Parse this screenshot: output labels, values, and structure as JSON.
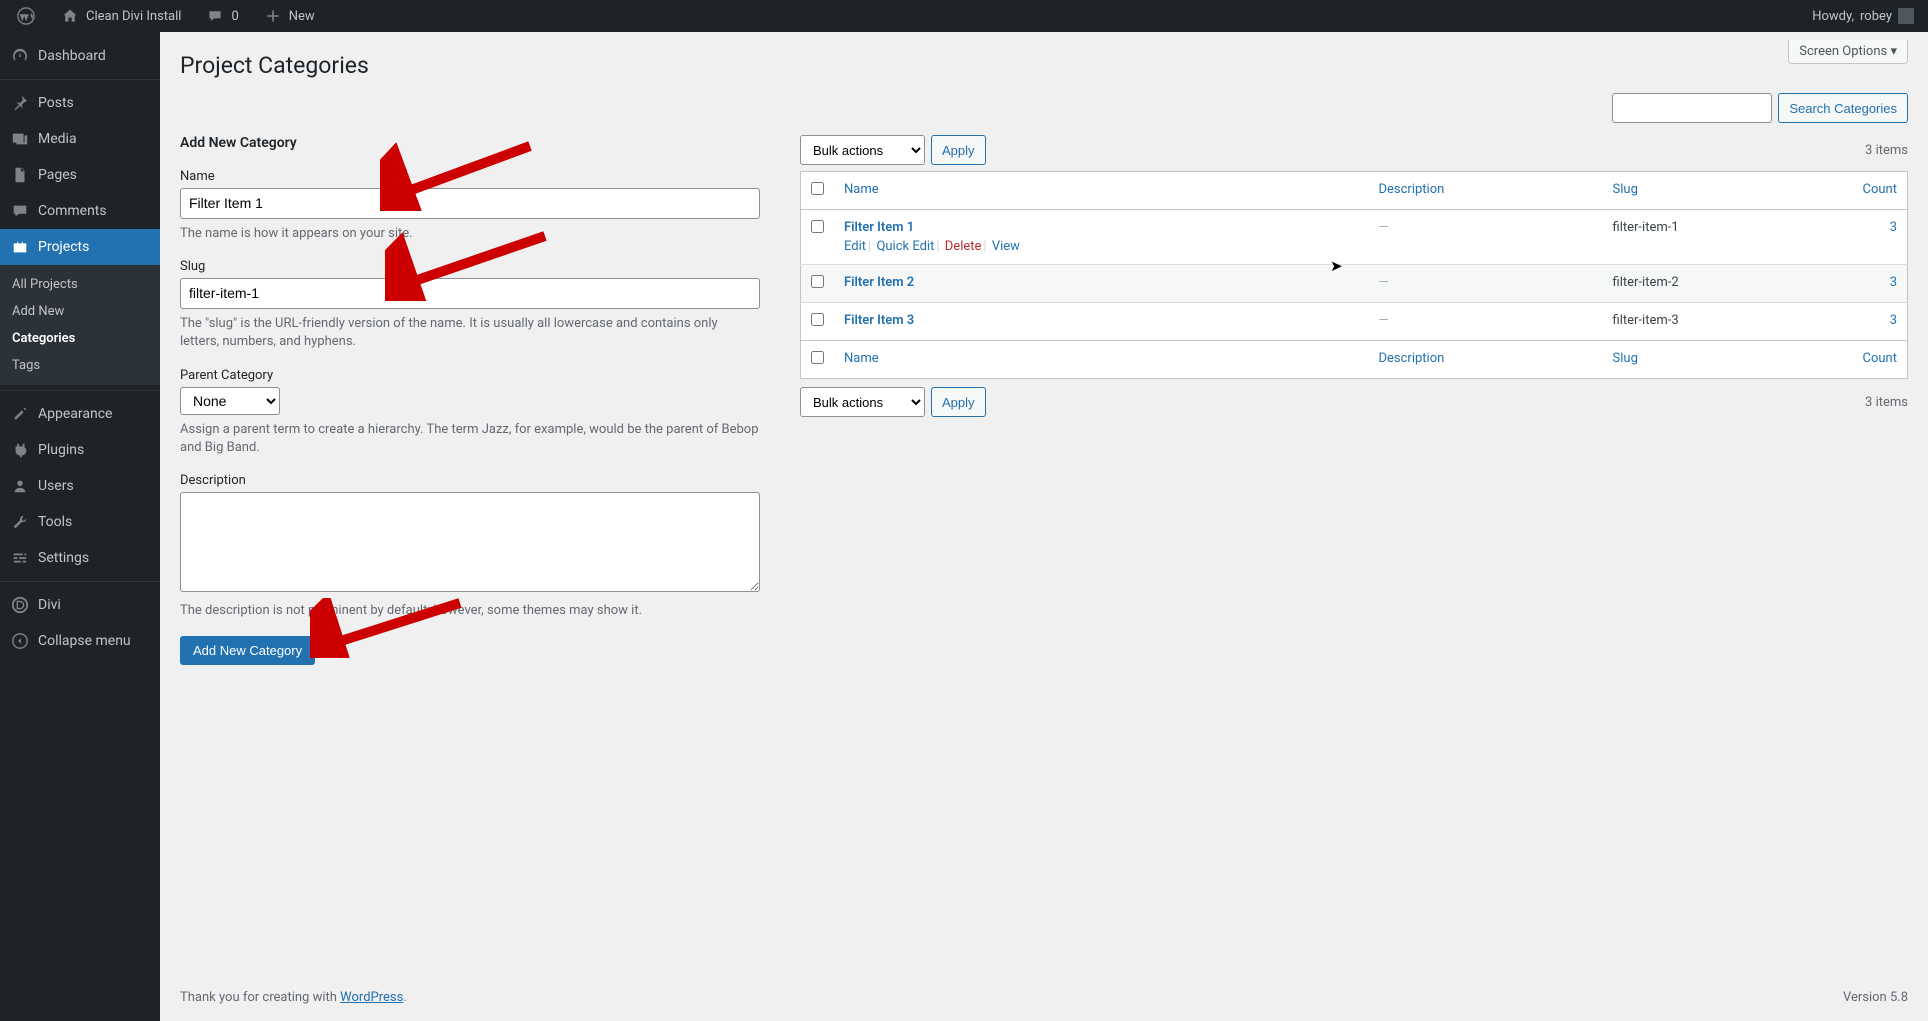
{
  "adminbar": {
    "site_name": "Clean Divi Install",
    "comments_count": "0",
    "new_label": "New",
    "howdy_prefix": "Howdy, ",
    "user": "robey"
  },
  "sidebar": {
    "dashboard": "Dashboard",
    "posts": "Posts",
    "media": "Media",
    "pages": "Pages",
    "comments": "Comments",
    "projects": "Projects",
    "submenu": {
      "all": "All Projects",
      "add": "Add New",
      "categories": "Categories",
      "tags": "Tags"
    },
    "appearance": "Appearance",
    "plugins": "Plugins",
    "users": "Users",
    "tools": "Tools",
    "settings": "Settings",
    "divi": "Divi",
    "collapse": "Collapse menu"
  },
  "page": {
    "title": "Project Categories",
    "screen_options": "Screen Options"
  },
  "form": {
    "heading": "Add New Category",
    "name_label": "Name",
    "name_value": "Filter Item 1",
    "name_help": "The name is how it appears on your site.",
    "slug_label": "Slug",
    "slug_value": "filter-item-1",
    "slug_help": "The \"slug\" is the URL-friendly version of the name. It is usually all lowercase and contains only letters, numbers, and hyphens.",
    "parent_label": "Parent Category",
    "parent_value": "None",
    "parent_help": "Assign a parent term to create a hierarchy. The term Jazz, for example, would be the parent of Bebop and Big Band.",
    "desc_label": "Description",
    "desc_value": "",
    "desc_help": "The description is not prominent by default; however, some themes may show it.",
    "submit": "Add New Category"
  },
  "table": {
    "search_button": "Search Categories",
    "bulk_actions_label": "Bulk actions",
    "apply_label": "Apply",
    "items_count": "3 items",
    "col_name": "Name",
    "col_desc": "Description",
    "col_slug": "Slug",
    "col_count": "Count",
    "row_actions": {
      "edit": "Edit",
      "quick_edit": "Quick Edit",
      "delete": "Delete",
      "view": "View"
    },
    "rows": [
      {
        "name": "Filter Item 1",
        "desc": "—",
        "slug": "filter-item-1",
        "count": "3",
        "hover": true
      },
      {
        "name": "Filter Item 2",
        "desc": "—",
        "slug": "filter-item-2",
        "count": "3",
        "hover": false
      },
      {
        "name": "Filter Item 3",
        "desc": "—",
        "slug": "filter-item-3",
        "count": "3",
        "hover": false
      }
    ]
  },
  "footer": {
    "thanks_prefix": "Thank you for creating with ",
    "wp_link": "WordPress",
    "version": "Version 5.8"
  }
}
